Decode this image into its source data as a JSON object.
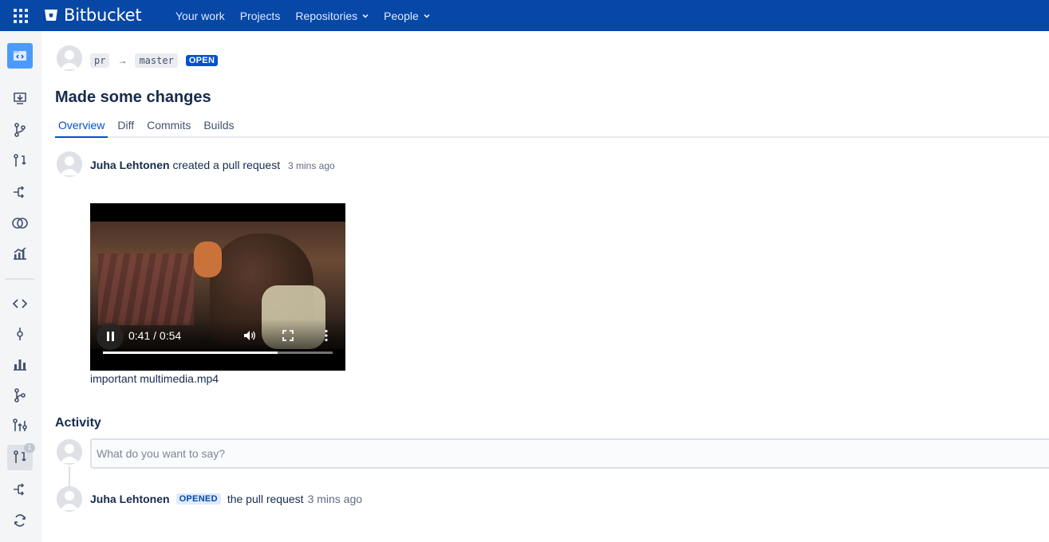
{
  "app": {
    "brand": "Bitbucket"
  },
  "nav": {
    "items": [
      {
        "label": "Your work",
        "dropdown": false
      },
      {
        "label": "Projects",
        "dropdown": false
      },
      {
        "label": "Repositories",
        "dropdown": true
      },
      {
        "label": "People",
        "dropdown": true
      }
    ]
  },
  "sidebar": {
    "icons": [
      "repository-icon",
      "clone-icon",
      "branches-icon",
      "pull-requests-icon",
      "pipelines-icon",
      "compare-icon",
      "insights-icon",
      "source-icon",
      "commits-icon",
      "reports-icon",
      "branches-secondary-icon",
      "forks-icon",
      "pull-requests-active-icon",
      "pipelines-secondary-icon",
      "sync-icon"
    ],
    "pr_badge": "1"
  },
  "pr": {
    "source_branch": "pr",
    "arrow": "→",
    "target_branch": "master",
    "state": "OPEN",
    "title": "Made some changes"
  },
  "tabs": [
    {
      "label": "Overview",
      "active": true
    },
    {
      "label": "Diff",
      "active": false
    },
    {
      "label": "Commits",
      "active": false
    },
    {
      "label": "Builds",
      "active": false
    }
  ],
  "created": {
    "author": "Juha Lehtonen",
    "action": "created a pull request",
    "time": "3 mins ago"
  },
  "attachment": {
    "time": "0:41 / 0:54",
    "progress": 0.76,
    "file_name": "important multimedia.mp4"
  },
  "activity": {
    "title": "Activity",
    "comment_placeholder": "What do you want to say?",
    "event": {
      "author": "Juha Lehtonen",
      "badge": "OPENED",
      "action": "the pull request",
      "time": "3 mins ago"
    }
  },
  "colors": {
    "topbar": "#0747a6",
    "link": "#0052cc",
    "sidebar": "#f4f5f7",
    "text": "#172b4d"
  }
}
